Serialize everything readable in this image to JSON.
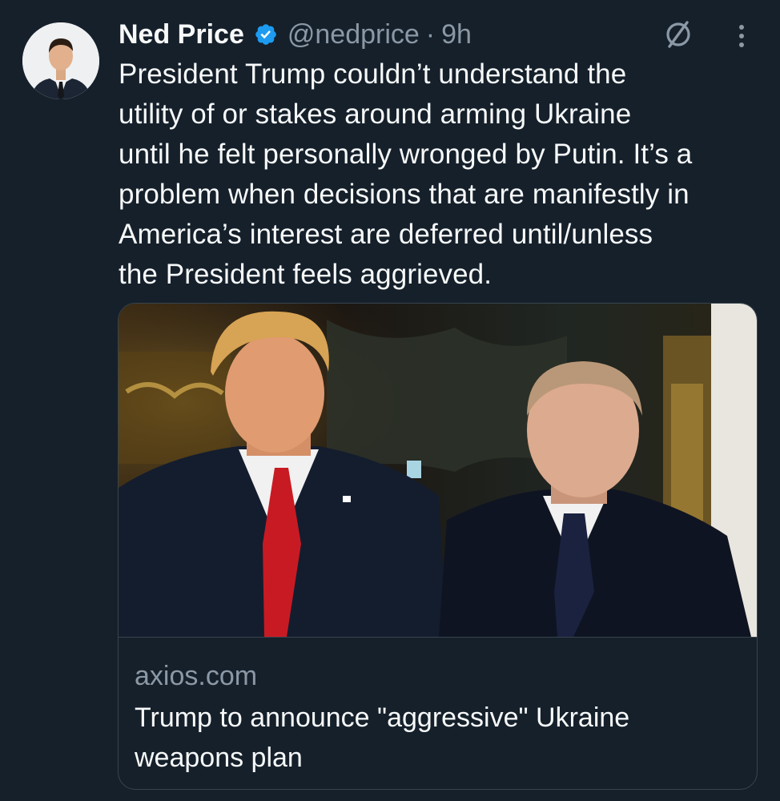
{
  "author": {
    "name": "Ned Price",
    "handle": "@nedprice",
    "separator": "·",
    "time": "9h",
    "verified": true,
    "avatar_icon": "profile-photo"
  },
  "actions": {
    "grok_icon": "grok-icon",
    "more_icon": "more-options-icon"
  },
  "tweet": {
    "lines": [
      "President Trump couldn’t understand the",
      "utility of or stakes around arming Ukraine",
      "until he felt personally wronged by Putin. It’s a",
      "problem when decisions that are manifestly in",
      "America’s interest are deferred until/unless",
      "the President feels aggrieved."
    ]
  },
  "card": {
    "image_icon": "news-photo",
    "domain": "axios.com",
    "title_lines": [
      "Trump to announce \"aggressive\" Ukraine",
      "weapons plan"
    ]
  },
  "colors": {
    "background": "#15202b",
    "text": "#f7f9f9",
    "secondary": "#8b98a5",
    "verified": "#1d9bf0",
    "border": "#38444d"
  }
}
